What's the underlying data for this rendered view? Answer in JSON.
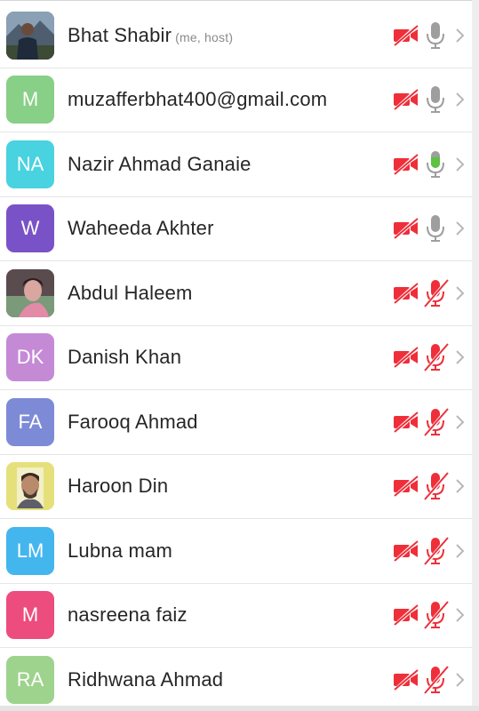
{
  "participants": [
    {
      "name": "Bhat Shabir",
      "tag": "(me, host)",
      "initials": "",
      "color": "#3a4a5c",
      "avatar": "photo-man-mountains",
      "mic": "available"
    },
    {
      "name": "muzafferbhat400@gmail.com",
      "tag": "",
      "initials": "M",
      "color": "#88cf87",
      "avatar": "initials",
      "mic": "available"
    },
    {
      "name": "Nazir Ahmad Ganaie",
      "tag": "",
      "initials": "NA",
      "color": "#49d2e0",
      "avatar": "initials",
      "mic": "speaking"
    },
    {
      "name": "Waheeda Akhter",
      "tag": "",
      "initials": "W",
      "color": "#7a52c7",
      "avatar": "initials",
      "mic": "available"
    },
    {
      "name": "Abdul Haleem",
      "tag": "",
      "initials": "",
      "color": "#b48a8f",
      "avatar": "photo-child",
      "mic": "muted"
    },
    {
      "name": "Danish Khan",
      "tag": "",
      "initials": "DK",
      "color": "#c58ad6",
      "avatar": "initials",
      "mic": "muted"
    },
    {
      "name": "Farooq Ahmad",
      "tag": "",
      "initials": "FA",
      "color": "#7d8bd6",
      "avatar": "initials",
      "mic": "muted"
    },
    {
      "name": "Haroon Din",
      "tag": "",
      "initials": "",
      "color": "#e6e07a",
      "avatar": "photo-man-beard",
      "mic": "muted"
    },
    {
      "name": "Lubna mam",
      "tag": "",
      "initials": "LM",
      "color": "#44b6ee",
      "avatar": "initials",
      "mic": "muted"
    },
    {
      "name": "nasreena faiz",
      "tag": "",
      "initials": "M",
      "color": "#ec4c7e",
      "avatar": "initials",
      "mic": "muted"
    },
    {
      "name": "Ridhwana Ahmad",
      "tag": "",
      "initials": "RA",
      "color": "#9ed38d",
      "avatar": "initials",
      "mic": "muted"
    }
  ],
  "icons": {
    "video": "video-off-icon",
    "mic_available": "mic-icon",
    "mic_speaking": "mic-active-icon",
    "mic_muted": "mic-off-icon",
    "chevron": "chevron-right-icon"
  },
  "colors": {
    "muted_red": "#ee2f3a",
    "mic_gray": "#9e9e9e",
    "mic_green": "#5cc241",
    "chevron": "#b8b8b8"
  }
}
